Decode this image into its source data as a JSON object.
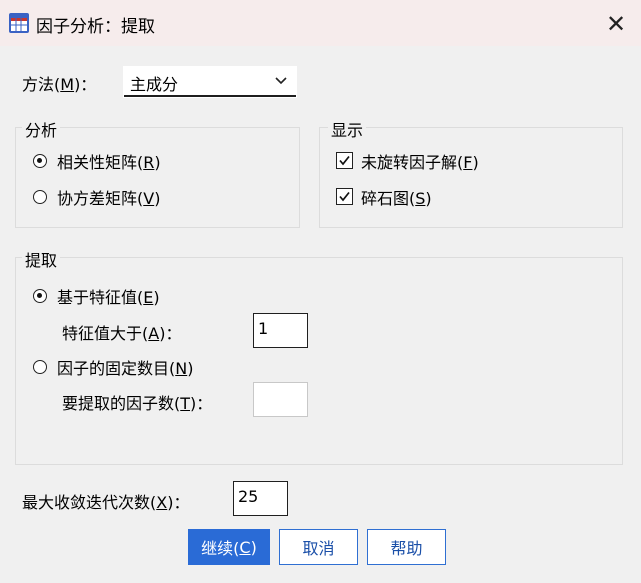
{
  "window": {
    "title": "因子分析：提取",
    "close_glyph": "✕"
  },
  "method": {
    "label_pre": "方法(",
    "label_key": "M",
    "label_post": ")：",
    "selected": "主成分"
  },
  "analysis": {
    "legend": "分析",
    "options": [
      {
        "pre": "相关性矩阵(",
        "key": "R",
        "post": ")",
        "selected": true
      },
      {
        "pre": "协方差矩阵(",
        "key": "V",
        "post": ")",
        "selected": false
      }
    ]
  },
  "display": {
    "legend": "显示",
    "options": [
      {
        "pre": "未旋转因子解(",
        "key": "F",
        "post": ")",
        "checked": true
      },
      {
        "pre": "碎石图(",
        "key": "S",
        "post": ")",
        "checked": true
      }
    ]
  },
  "extract": {
    "legend": "提取",
    "eigen_option": {
      "pre": "基于特征值(",
      "key": "E",
      "post": ")",
      "selected": true
    },
    "eigen_label": {
      "pre": "特征值大于(",
      "key": "A",
      "post": ")："
    },
    "eigen_value": "1",
    "fixed_option": {
      "pre": "因子的固定数目(",
      "key": "N",
      "post": ")",
      "selected": false
    },
    "fixed_label": {
      "pre": "要提取的因子数(",
      "key": "T",
      "post": ")："
    },
    "fixed_value": ""
  },
  "iterations": {
    "pre": "最大收敛迭代次数(",
    "key": "X",
    "post": ")：",
    "value": "25"
  },
  "buttons": {
    "continue": {
      "pre": "继续(",
      "key": "C",
      "post": ")"
    },
    "cancel": "取消",
    "help": "帮助"
  },
  "colors": {
    "primary": "#2a6bd6",
    "title_bg": "#f6ecec"
  }
}
